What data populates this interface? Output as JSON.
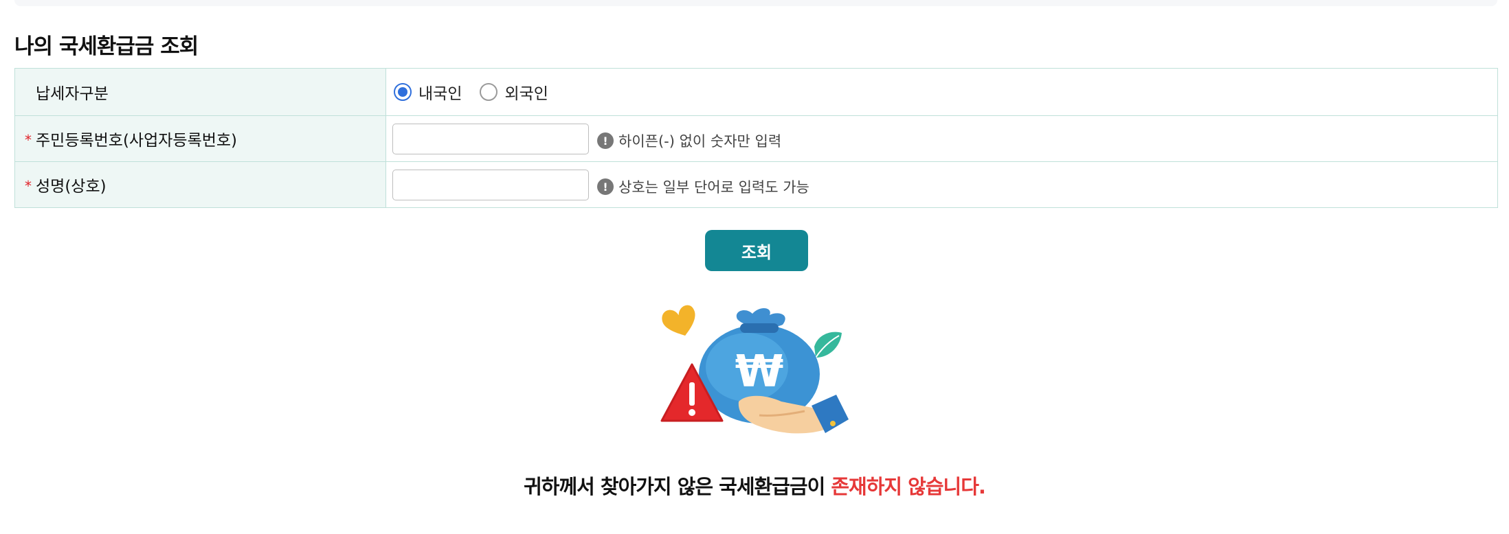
{
  "page": {
    "title": "나의 국세환급금 조회"
  },
  "form": {
    "taxpayer_type": {
      "label": "납세자구분",
      "options": [
        "내국인",
        "외국인"
      ],
      "selected": "내국인"
    },
    "resident_number": {
      "required_mark": "*",
      "label": "주민등록번호(사업자등록번호)",
      "value": "",
      "hint": "하이픈(-) 없이 숫자만 입력"
    },
    "name": {
      "required_mark": "*",
      "label": "성명(상호)",
      "value": "",
      "hint": "상호는 일부 단어로 입력도 가능"
    },
    "hint_icon_glyph": "!",
    "submit_label": "조회"
  },
  "result": {
    "message_main": "귀하께서 찾아가지 않은 국세환급금이 ",
    "message_highlight": "존재하지 않습니다.",
    "illustration_icon": "money-bag-warning-icon",
    "currency_symbol": "₩"
  },
  "colors": {
    "accent": "#138794",
    "required": "#e0242b",
    "highlight": "#e63838",
    "header_bg": "#eef7f5",
    "border": "#bfe0d9",
    "radio_selected": "#2f6fdc"
  }
}
